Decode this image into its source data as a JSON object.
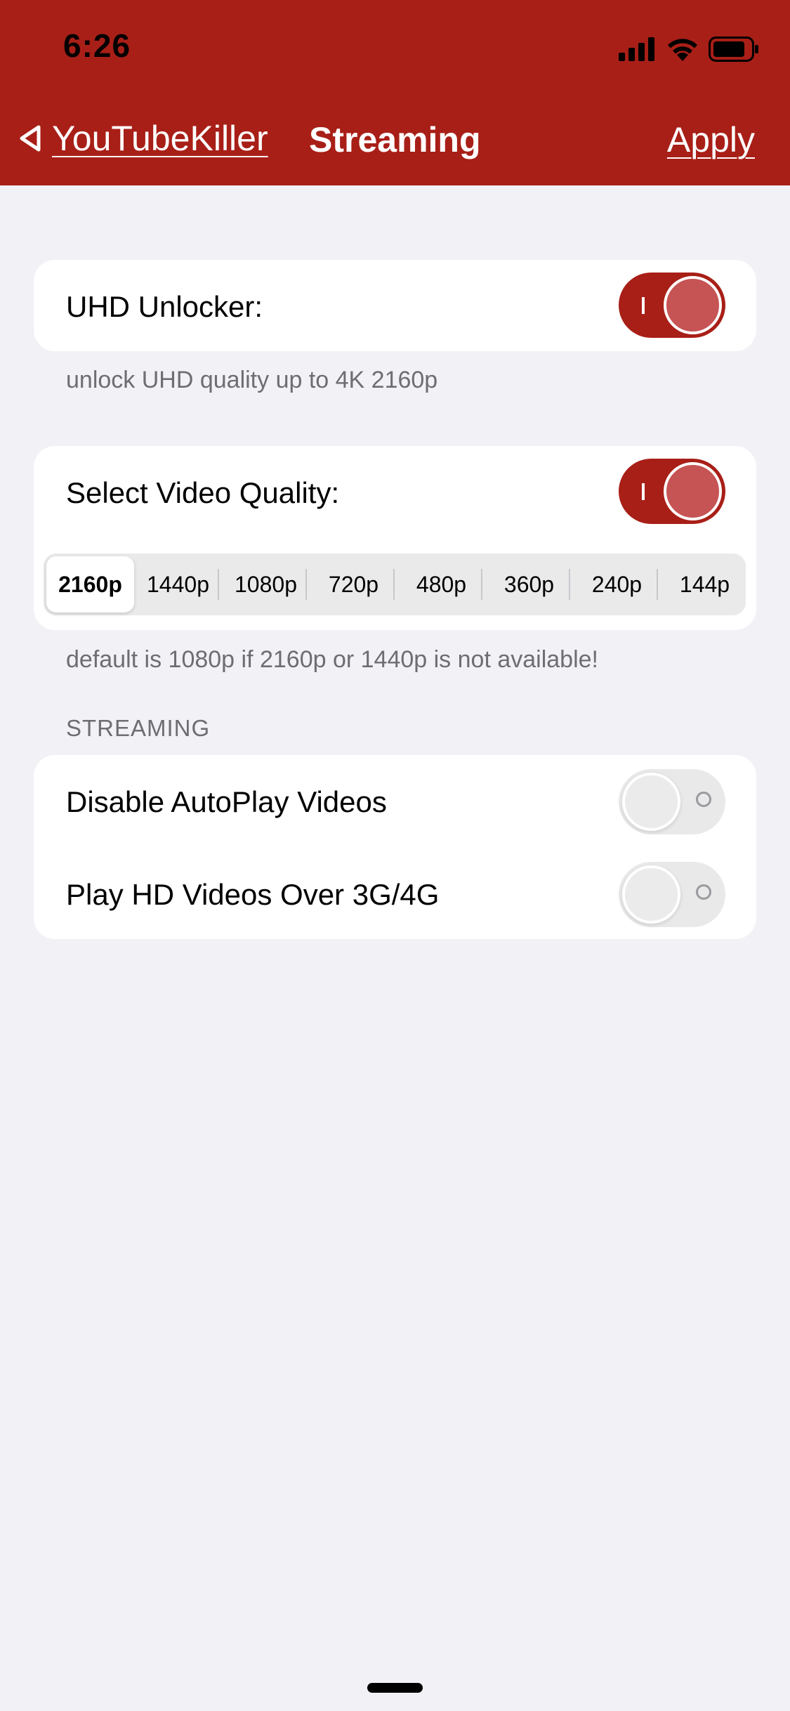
{
  "status_bar": {
    "time": "6:26",
    "icons": [
      "signal-icon",
      "wifi-icon",
      "battery-icon"
    ]
  },
  "nav": {
    "back_label": "YouTubeKiller",
    "title": "Streaming",
    "apply_label": "Apply",
    "back_icon": "back-chevron-icon"
  },
  "colors": {
    "accent": "#a81f17",
    "background": "#f1f1f6",
    "toggle_on_knob": "#c65454",
    "secondary_text": "#6d6d72"
  },
  "uhd_card": {
    "label": "UHD Unlocker:",
    "toggle_on": true,
    "footnote": "unlock UHD quality up to 4K 2160p"
  },
  "quality_card": {
    "label": "Select Video Quality:",
    "toggle_on": true,
    "options": [
      "2160p",
      "1440p",
      "1080p",
      "720p",
      "480p",
      "360p",
      "240p",
      "144p"
    ],
    "selected": "2160p",
    "footnote": "default is 1080p if 2160p or 1440p is not available!"
  },
  "streaming_section": {
    "header": "STREAMING",
    "rows": [
      {
        "label": "Disable AutoPlay Videos",
        "toggle_on": false
      },
      {
        "label": "Play HD Videos Over 3G/4G",
        "toggle_on": false
      }
    ]
  }
}
